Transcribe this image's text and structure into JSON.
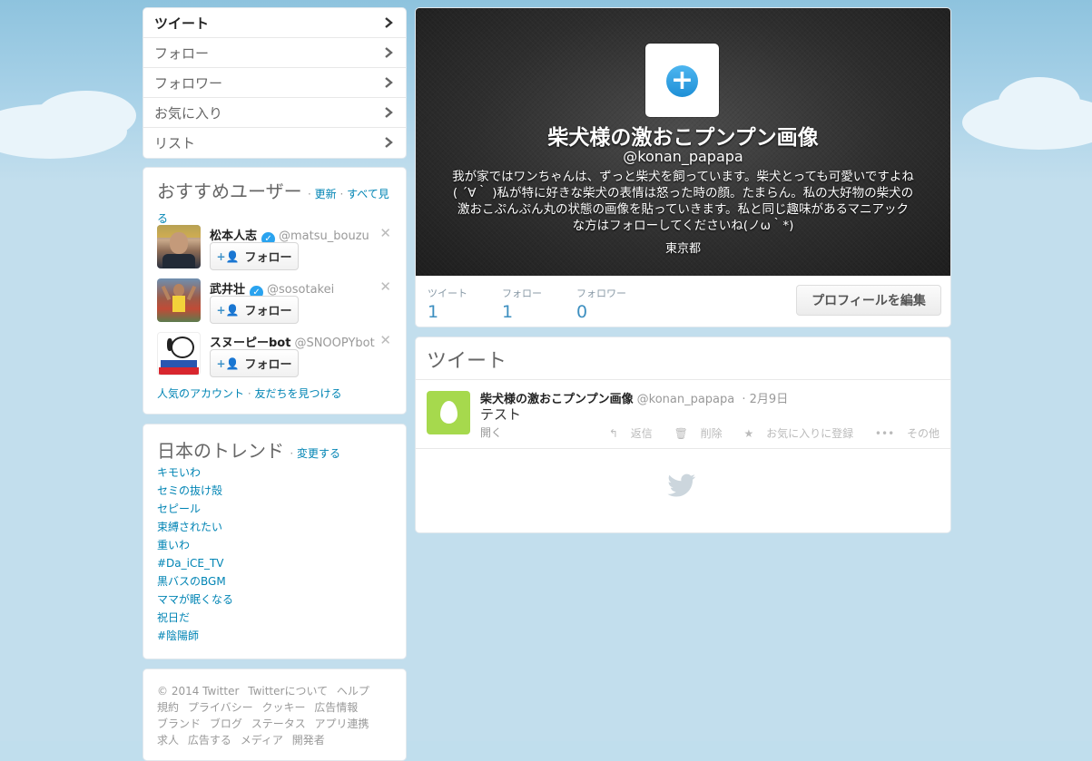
{
  "nav": {
    "items": [
      {
        "label": "ツイート"
      },
      {
        "label": "フォロー"
      },
      {
        "label": "フォロワー"
      },
      {
        "label": "お気に入り"
      },
      {
        "label": "リスト"
      }
    ]
  },
  "who_to_follow": {
    "title": "おすすめユーザー",
    "refresh": "更新",
    "view_all": "すべて見る",
    "users": [
      {
        "name": "松本人志",
        "handle": "@matsu_bouzu",
        "follow_label": "フォロー"
      },
      {
        "name": "武井壮",
        "handle": "@sosotakei",
        "follow_label": "フォロー"
      },
      {
        "name": "スヌーピーbot",
        "handle": "@SNOOPYbot",
        "follow_label": "フォロー"
      }
    ],
    "popular_accounts": "人気のアカウント",
    "find_friends": "友だちを見つける"
  },
  "trends": {
    "title": "日本のトレンド",
    "change": "変更する",
    "items": [
      "キモいわ",
      "セミの抜け殻",
      "セピール",
      "束縛されたい",
      "重いわ",
      "#Da_iCE_TV",
      "黒バスのBGM",
      "ママが眠くなる",
      "祝日だ",
      "#陰陽師"
    ]
  },
  "footer": {
    "links": [
      "© 2014 Twitter",
      "Twitterについて",
      "ヘルプ",
      "規約",
      "プライバシー",
      "クッキー",
      "広告情報",
      "ブランド",
      "ブログ",
      "ステータス",
      "アプリ連携",
      "求人",
      "広告する",
      "メディア",
      "開発者"
    ]
  },
  "profile": {
    "name": "柴犬様の激おこプンプン画像",
    "handle": "@konan_papapa",
    "bio": "我が家ではワンちゃんは、ずっと柴犬を飼っています。柴犬とっても可愛いですよね( ´∀｀ )私が特に好きな柴犬の表情は怒った時の顔。たまらん。私の大好物の柴犬の激おこぷんぷん丸の状態の画像を貼っていきます。私と同じ趣味があるマニアックな方はフォローしてくださいね(ノω｀*)",
    "location": "東京都",
    "stats": [
      {
        "label": "ツイート",
        "value": "1"
      },
      {
        "label": "フォロー",
        "value": "1"
      },
      {
        "label": "フォロワー",
        "value": "0"
      }
    ],
    "edit_button": "プロフィールを編集"
  },
  "tweets": {
    "title": "ツイート",
    "items": [
      {
        "name": "柴犬様の激おこプンプン画像",
        "handle": "@konan_papapa",
        "date": "2月9日",
        "text": "テスト",
        "open": "開く",
        "actions": {
          "reply": "返信",
          "delete": "削除",
          "favorite": "お気に入りに登録",
          "more": "その他"
        }
      }
    ]
  },
  "colors": {
    "link": "#0084b4",
    "accent": "#2aa3ef",
    "stat": "#3d8fc0"
  }
}
